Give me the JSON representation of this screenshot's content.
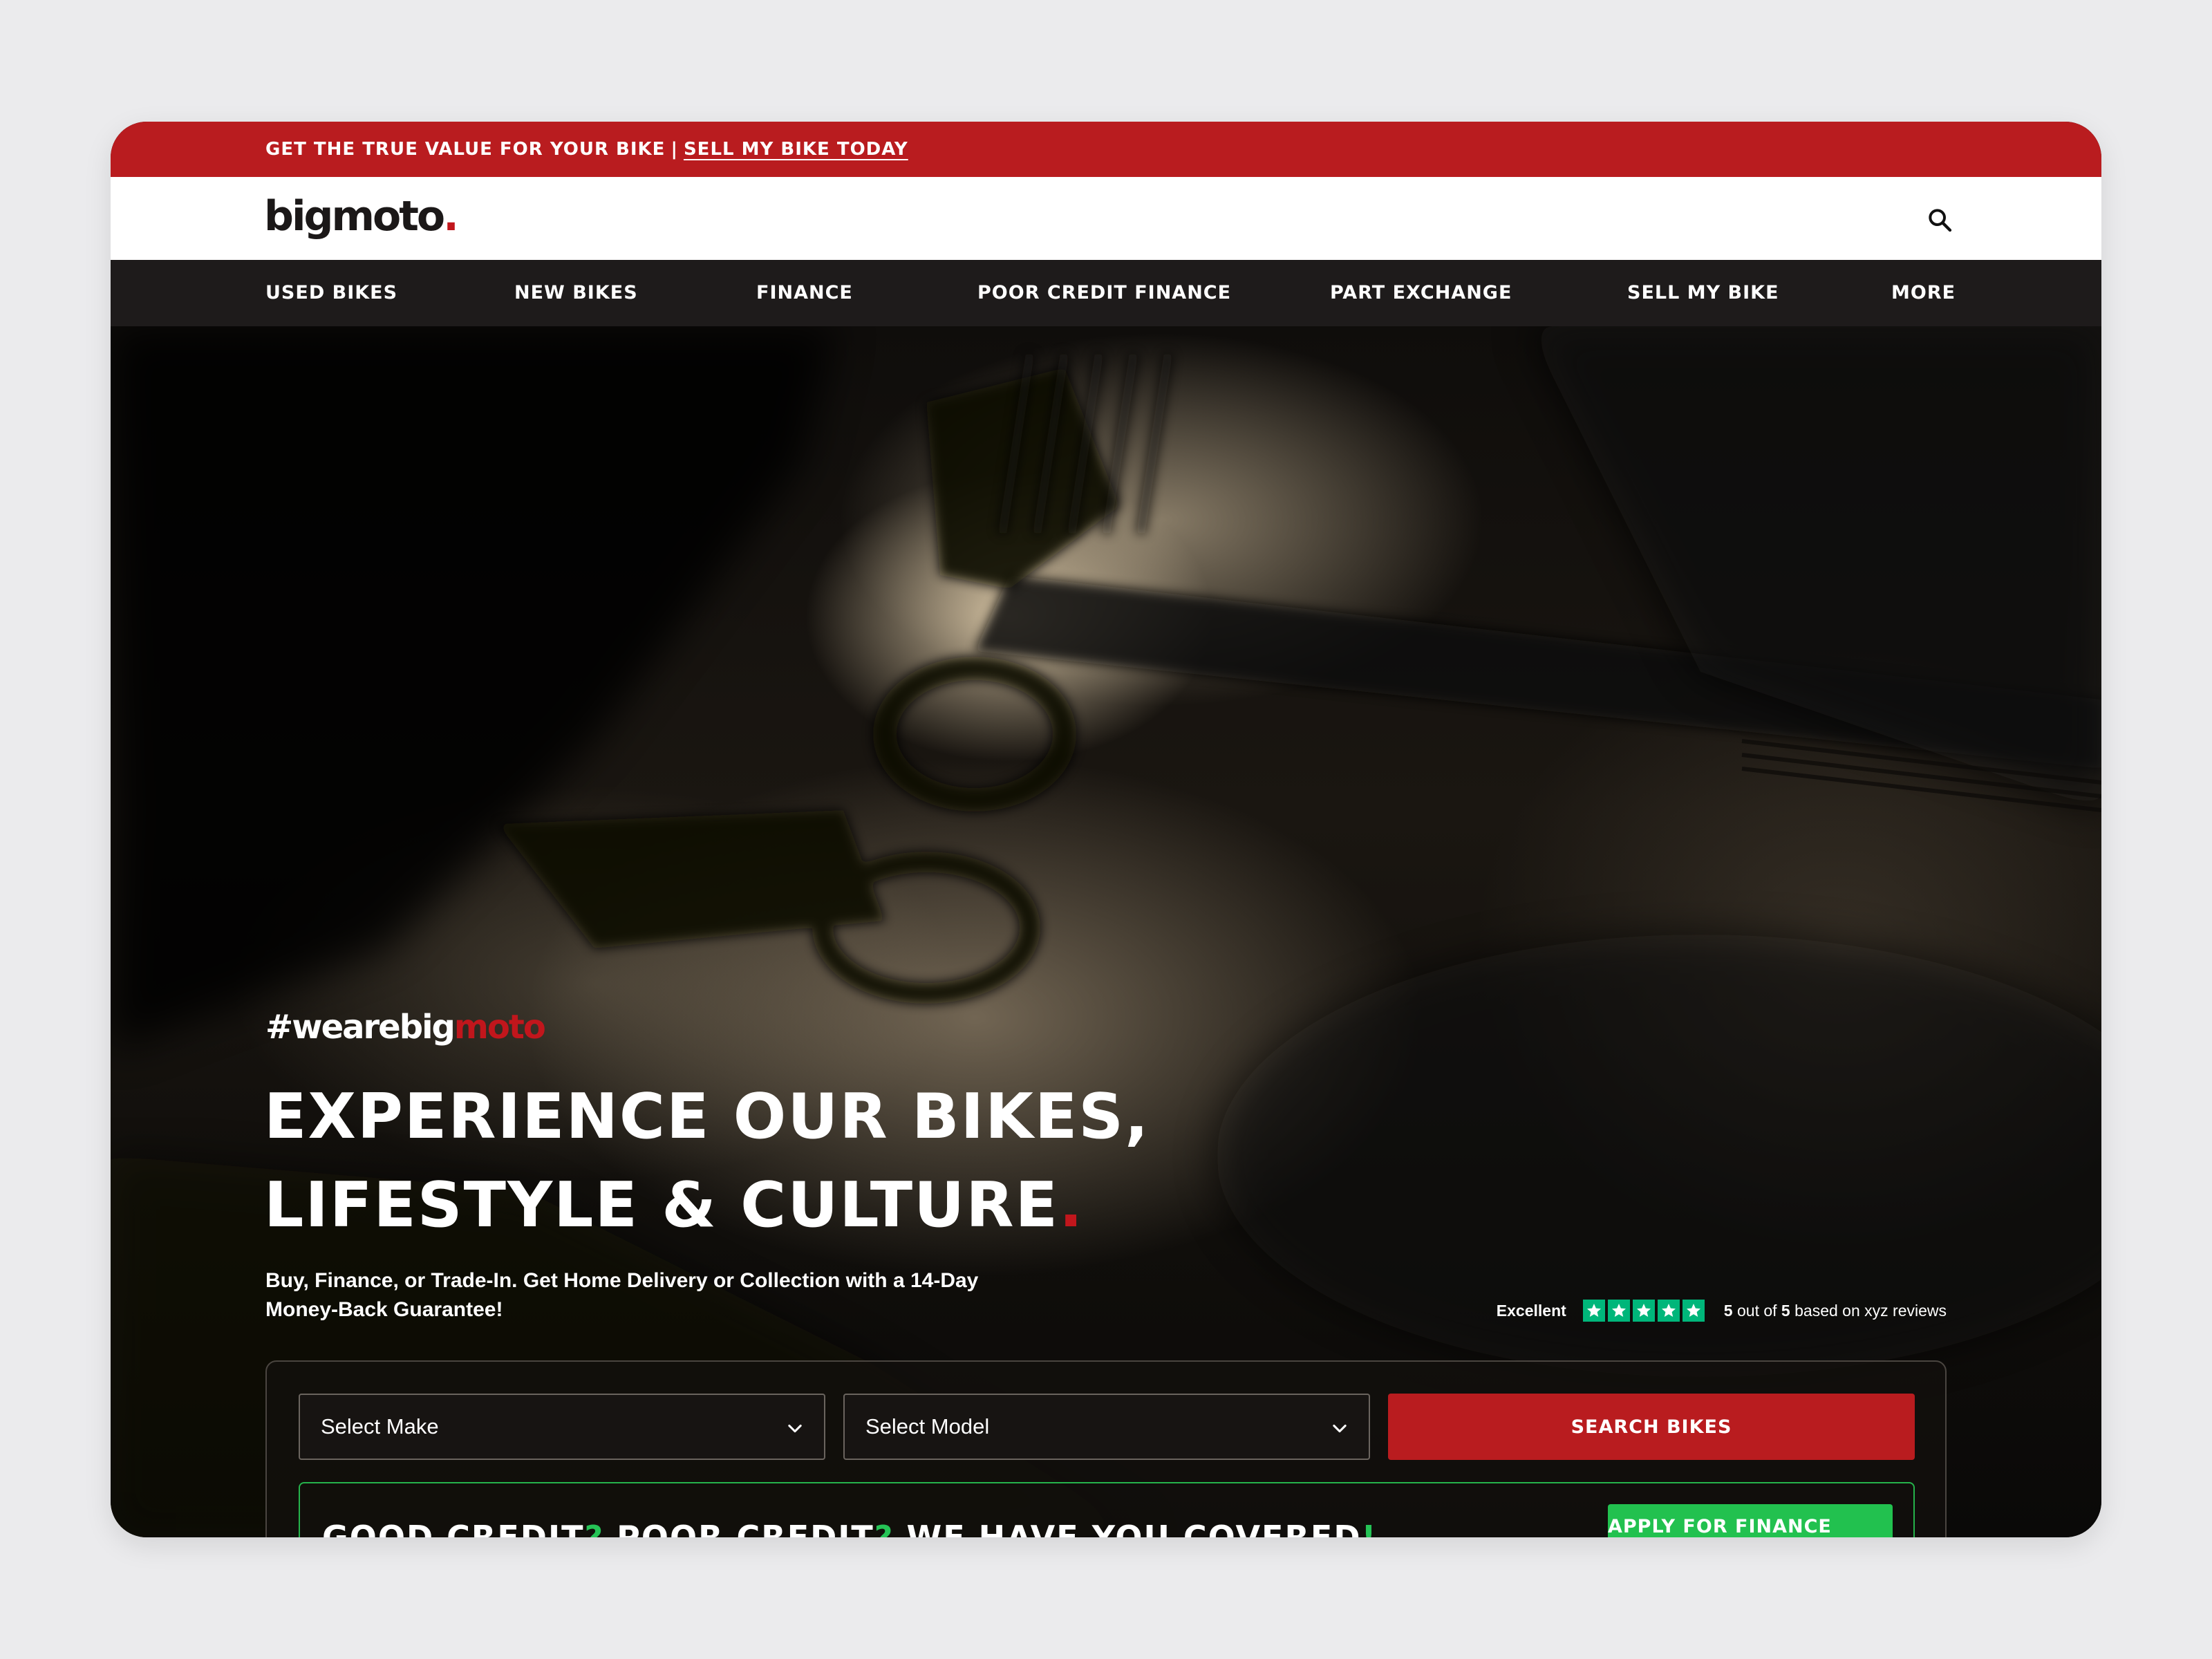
{
  "promo": {
    "text": "GET THE TRUE VALUE FOR YOUR BIKE",
    "separator": "|",
    "link": "SELL MY BIKE TODAY"
  },
  "header": {
    "logo_text": "bigmoto",
    "logo_dot": ".",
    "search_icon": "search-icon"
  },
  "nav": {
    "items": [
      {
        "label": "USED BIKES"
      },
      {
        "label": "NEW BIKES"
      },
      {
        "label": "FINANCE"
      },
      {
        "label": "POOR CREDIT FINANCE"
      },
      {
        "label": "PART EXCHANGE"
      },
      {
        "label": "SELL MY BIKE"
      },
      {
        "label": "MORE"
      }
    ]
  },
  "hero": {
    "hashtag_prefix": "#wearebig",
    "hashtag_suffix": "moto",
    "headline_line1": "EXPERIENCE OUR BIKES,",
    "headline_line2": "LIFESTYLE & CULTURE",
    "headline_dot": ".",
    "subcopy": "Buy, Finance, or Trade-In. Get Home Delivery or Collection with a 14-Day Money-Back Guarantee!"
  },
  "rating": {
    "label": "Excellent",
    "stars": 5,
    "score": "5",
    "out_of_text": "out of",
    "max": "5",
    "based_on_text": "based on xyz reviews"
  },
  "search": {
    "make_placeholder": "Select Make",
    "model_placeholder": "Select Model",
    "search_label": "SEARCH BIKES"
  },
  "finance_banner": {
    "part1": "GOOD CREDIT",
    "q1": "?",
    "part2": " POOR CREDIT",
    "q2": "?",
    "part3": " WE HAVE YOU COVERED",
    "excl": "!",
    "button_label": "APPLY FOR FINANCE NOW"
  },
  "colors": {
    "brand_red": "#b91c1f",
    "accent_green": "#22c14f",
    "trustpilot_green": "#00b67a",
    "nav_bg": "#1e1b1b"
  }
}
